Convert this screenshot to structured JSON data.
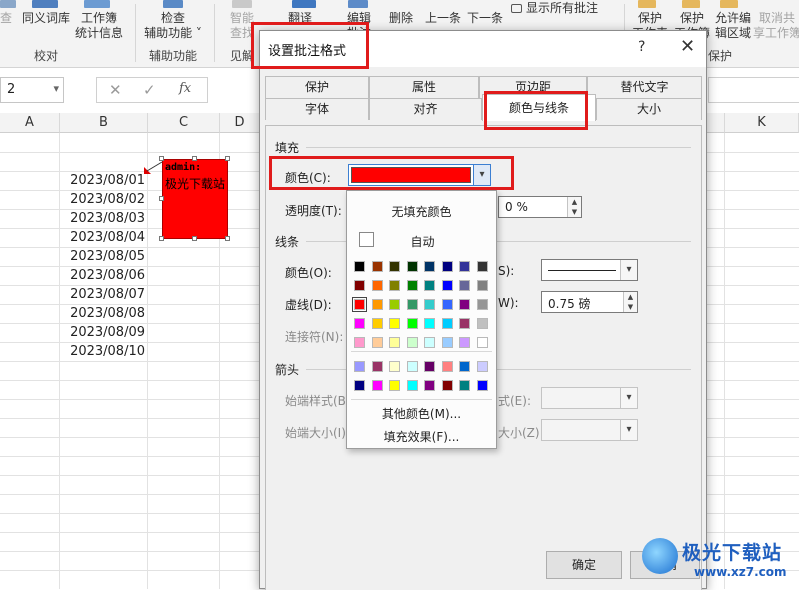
{
  "ribbon": {
    "buttons": {
      "check_cut": "查",
      "synonym": "同义词库",
      "workbook_stats_1": "工作簿",
      "workbook_stats_2": "统计信息",
      "check_1": "检查",
      "check_2": "辅助功能 ˅",
      "smart_1": "智能",
      "smart_2": "查找",
      "translate_1": "翻译",
      "edit_1": "编辑",
      "edit_2": "批注",
      "delete": "删除",
      "prev": "上一条",
      "next": "下一条",
      "show_all": "显示所有批注",
      "protect_sheet_1": "保护",
      "protect_sheet_2": "工作表",
      "protect_wb_1": "保护",
      "protect_wb_2": "工作簿",
      "allow_edit_1": "允许编",
      "allow_edit_2": "辑区域",
      "unshare_1": "取消共",
      "unshare_2": "享工作簿"
    },
    "groups": {
      "proofing": "校对",
      "accessibility": "辅助功能",
      "insights": "见解",
      "protect": "保护"
    }
  },
  "formula_bar": {
    "name_box": "2",
    "cancel_icon": "✕",
    "enter_icon": "✓",
    "fx_icon": "fx"
  },
  "sheet": {
    "columns": [
      "A",
      "B",
      "C",
      "D",
      "K"
    ],
    "dates": [
      "2023/08/01",
      "2023/08/02",
      "2023/08/03",
      "2023/08/04",
      "2023/08/05",
      "2023/08/06",
      "2023/08/07",
      "2023/08/08",
      "2023/08/09",
      "2023/08/10"
    ],
    "comment": {
      "author": "admin:",
      "text": "极光下载站",
      "fill_color": "#ff0000"
    }
  },
  "dialog": {
    "title": "设置批注格式",
    "help": "?",
    "close": "✕",
    "tabs_row1": [
      "保护",
      "属性",
      "页边距",
      "替代文字"
    ],
    "tabs_row2": [
      "字体",
      "对齐",
      "颜色与线条",
      "大小"
    ],
    "active_tab": "颜色与线条",
    "fill": {
      "section": "填充",
      "color_label": "颜色(C):",
      "color_value": "#ff0000",
      "transparency_label": "透明度(T):",
      "transparency_value": "0 %"
    },
    "line": {
      "section": "线条",
      "color_label": "颜色(O):",
      "style_label_suffix": "S):",
      "dash_label": "虚线(D):",
      "weight_label_suffix": "W):",
      "weight_value": "0.75 磅",
      "connector_label": "连接符(N):"
    },
    "arrows": {
      "section": "箭头",
      "begin_style": "始端样式(B)",
      "end_style_suffix": "式(E):",
      "begin_size": "始端大小(I):",
      "end_size_suffix": "大小(Z):"
    },
    "buttons": {
      "ok": "确定",
      "cancel": "取消"
    }
  },
  "color_picker": {
    "no_fill": "无填充颜色",
    "automatic": "自动",
    "more_colors": "其他颜色(M)...",
    "fill_effects": "填充效果(F)...",
    "selected": "#ff0000",
    "grid": [
      [
        "#000000",
        "#993300",
        "#333300",
        "#003300",
        "#003366",
        "#000080",
        "#333399",
        "#333333"
      ],
      [
        "#800000",
        "#ff6600",
        "#808000",
        "#008000",
        "#008080",
        "#0000ff",
        "#666699",
        "#808080"
      ],
      [
        "#ff0000",
        "#ff9900",
        "#99cc00",
        "#339966",
        "#33cccc",
        "#3366ff",
        "#800080",
        "#969696"
      ],
      [
        "#ff00ff",
        "#ffcc00",
        "#ffff00",
        "#00ff00",
        "#00ffff",
        "#00ccff",
        "#993366",
        "#c0c0c0"
      ],
      [
        "#ff99cc",
        "#ffcc99",
        "#ffff99",
        "#ccffcc",
        "#ccffff",
        "#99ccff",
        "#cc99ff",
        "#ffffff"
      ]
    ],
    "chart_colors": [
      [
        "#9999ff",
        "#993366",
        "#ffffcc",
        "#ccffff",
        "#660066",
        "#ff8080",
        "#0066cc",
        "#ccccff"
      ],
      [
        "#000080",
        "#ff00ff",
        "#ffff00",
        "#00ffff",
        "#800080",
        "#800000",
        "#008080",
        "#0000ff"
      ]
    ]
  },
  "watermark": {
    "name": "极光下载站",
    "url": "www.xz7.com"
  }
}
